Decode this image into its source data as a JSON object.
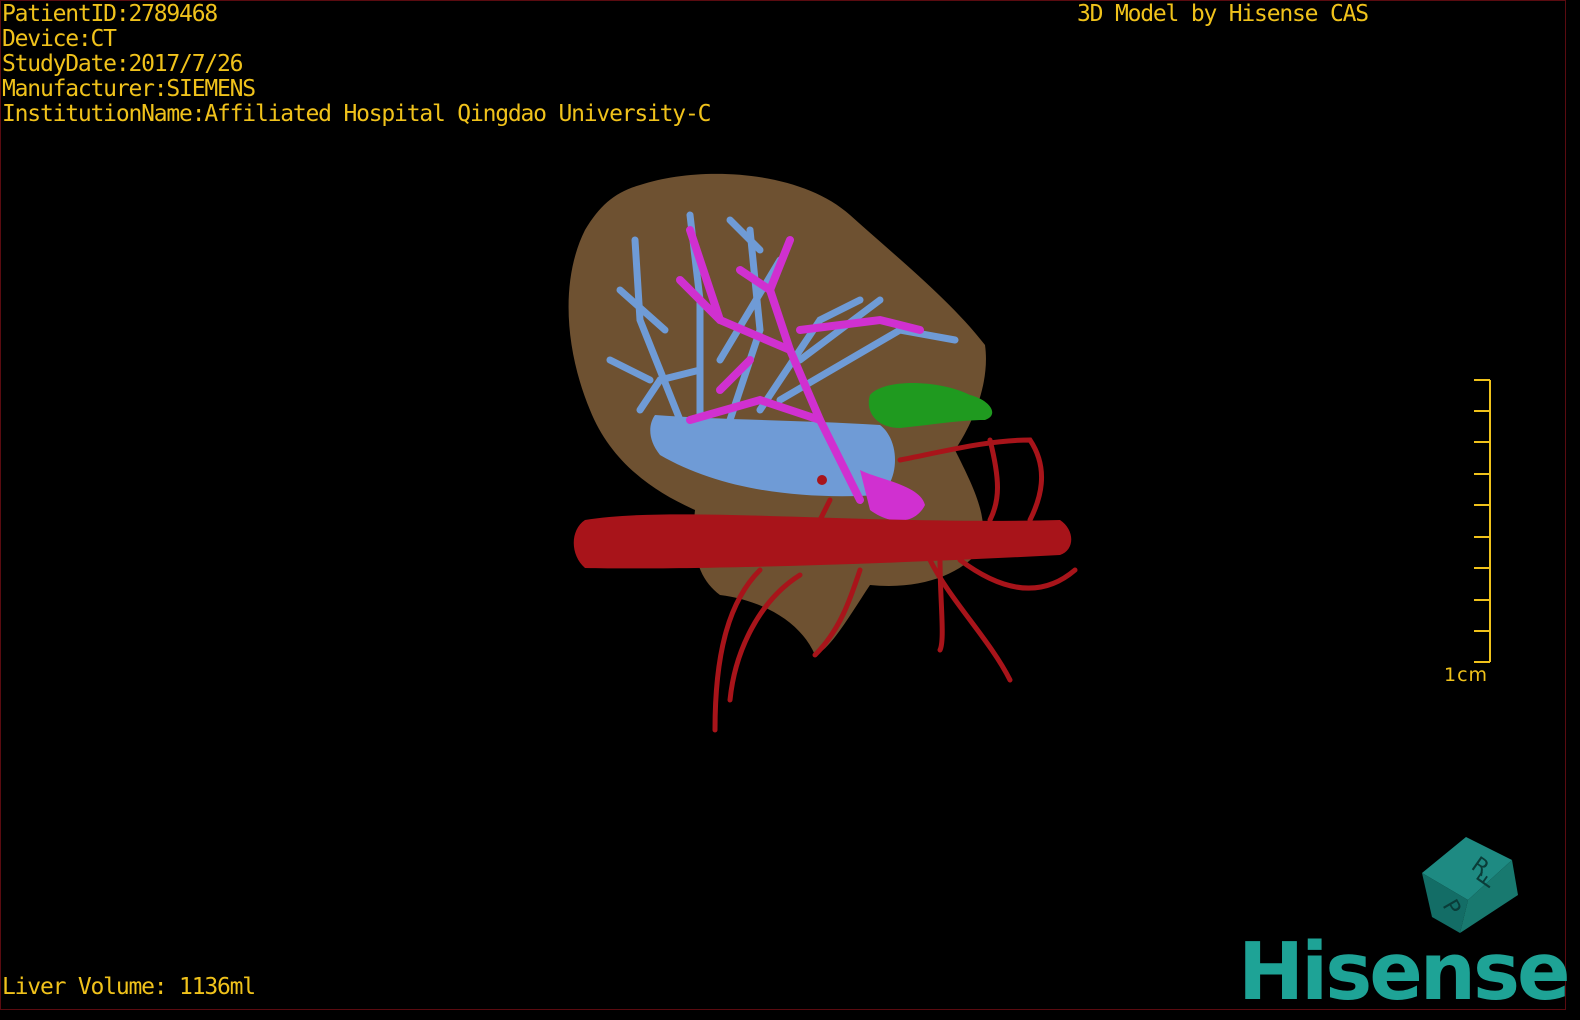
{
  "header": {
    "patient_id": "PatientID:2789468",
    "device": "Device:CT",
    "study_date": "StudyDate:2017/7/26",
    "manufacturer": "Manufacturer:SIEMENS",
    "institution": "InstitutionName:Affiliated Hospital Qingdao University-C"
  },
  "brand_caption": "3D Model by Hisense CAS",
  "footer": {
    "liver_volume": "Liver Volume: 1136ml"
  },
  "scale_bar": {
    "label": "1cm"
  },
  "orientation_cube": {
    "face_letters": [
      "R",
      "F",
      "P"
    ]
  },
  "logo": {
    "text": "Hisense"
  },
  "colors": {
    "overlay_text": "#f0c21b",
    "liver": "#7a5a36",
    "hepatic_vein": "#6f9bd6",
    "portal_vein": "#d030d0",
    "artery": "#a8141a",
    "gallbladder": "#1f9a1f",
    "logo": "#1ea396"
  },
  "icons": [
    "orientation-cube-icon",
    "hisense-logo"
  ]
}
